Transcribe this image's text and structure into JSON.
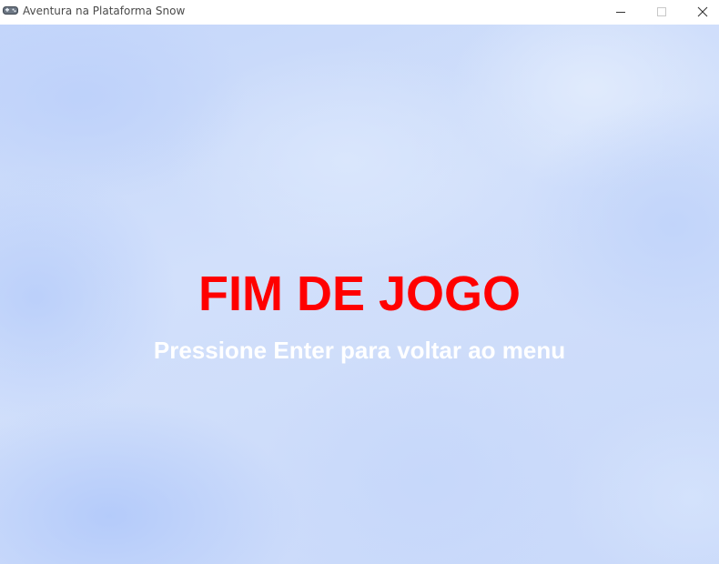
{
  "window": {
    "title": "Aventura na Plataforma Snow",
    "icon": "gamepad-icon",
    "controls": {
      "minimize_icon": "minimize-icon",
      "maximize_icon": "maximize-icon",
      "close_icon": "close-icon"
    }
  },
  "game": {
    "title": "FIM DE JOGO",
    "prompt": "Pressione Enter para voltar ao menu",
    "colors": {
      "title": "#ff0000",
      "prompt": "#ffffff",
      "sky": "#cddcfa"
    }
  }
}
